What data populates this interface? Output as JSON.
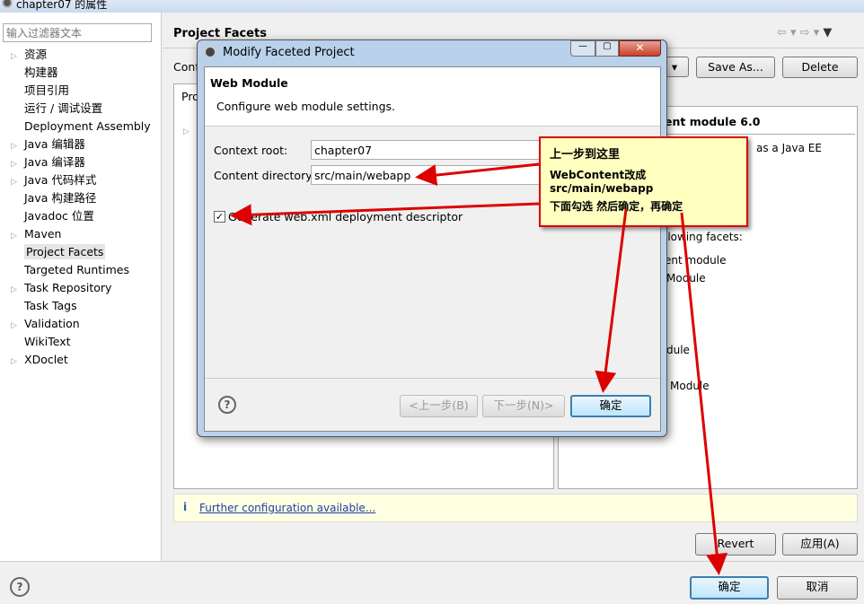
{
  "window": {
    "title": "chapter07 的属性"
  },
  "sidebar": {
    "filter_placeholder": "输入过滤器文本",
    "items": [
      {
        "label": "资源",
        "expandable": true
      },
      {
        "label": "构建器",
        "expandable": false
      },
      {
        "label": "项目引用",
        "expandable": false
      },
      {
        "label": "运行 / 调试设置",
        "expandable": false
      },
      {
        "label": "Deployment Assembly",
        "expandable": false
      },
      {
        "label": "Java 编辑器",
        "expandable": true
      },
      {
        "label": "Java 编译器",
        "expandable": true
      },
      {
        "label": "Java 代码样式",
        "expandable": true
      },
      {
        "label": "Java 构建路径",
        "expandable": false
      },
      {
        "label": "Javadoc 位置",
        "expandable": false
      },
      {
        "label": "Maven",
        "expandable": true
      },
      {
        "label": "Project Facets",
        "expandable": false,
        "selected": true
      },
      {
        "label": "Targeted Runtimes",
        "expandable": false
      },
      {
        "label": "Task Repository",
        "expandable": true
      },
      {
        "label": "Task Tags",
        "expandable": false
      },
      {
        "label": "Validation",
        "expandable": true
      },
      {
        "label": "WikiText",
        "expandable": false
      },
      {
        "label": "XDoclet",
        "expandable": true
      }
    ]
  },
  "main": {
    "title": "Project Facets",
    "config_label": "Conf",
    "save_as": "Save As...",
    "delete": "Delete",
    "tab_label": "Pro",
    "details_title": "ent module 6.0",
    "details_lines": [
      "as a Java EE",
      "llowing facets:",
      "ent module",
      "Module",
      "dule",
      "Module"
    ],
    "info_text": "Further configuration available...",
    "revert": "Revert",
    "apply": "应用(A)"
  },
  "footer": {
    "ok": "确定",
    "cancel": "取消"
  },
  "dialog": {
    "title": "Modify Faceted Project",
    "heading": "Web Module",
    "description": "Configure web module settings.",
    "context_root_label": "Context root:",
    "context_root_value": "chapter07",
    "content_dir_label": "Content directory:",
    "content_dir_value": "src/main/webapp",
    "generate_label": "Generate web.xml deployment descriptor",
    "generate_checked": true,
    "back": "<上一步(B)",
    "next": "下一步(N)>",
    "ok": "确定"
  },
  "callout": {
    "line1": "上一步到这里",
    "line2": "WebContent改成src/main/webapp",
    "line3": "下面勾选 然后确定，再确定"
  },
  "colors": {
    "annotation_red": "#dd0000",
    "callout_bg": "#ffffc0",
    "default_button": "#3c7fb1"
  }
}
